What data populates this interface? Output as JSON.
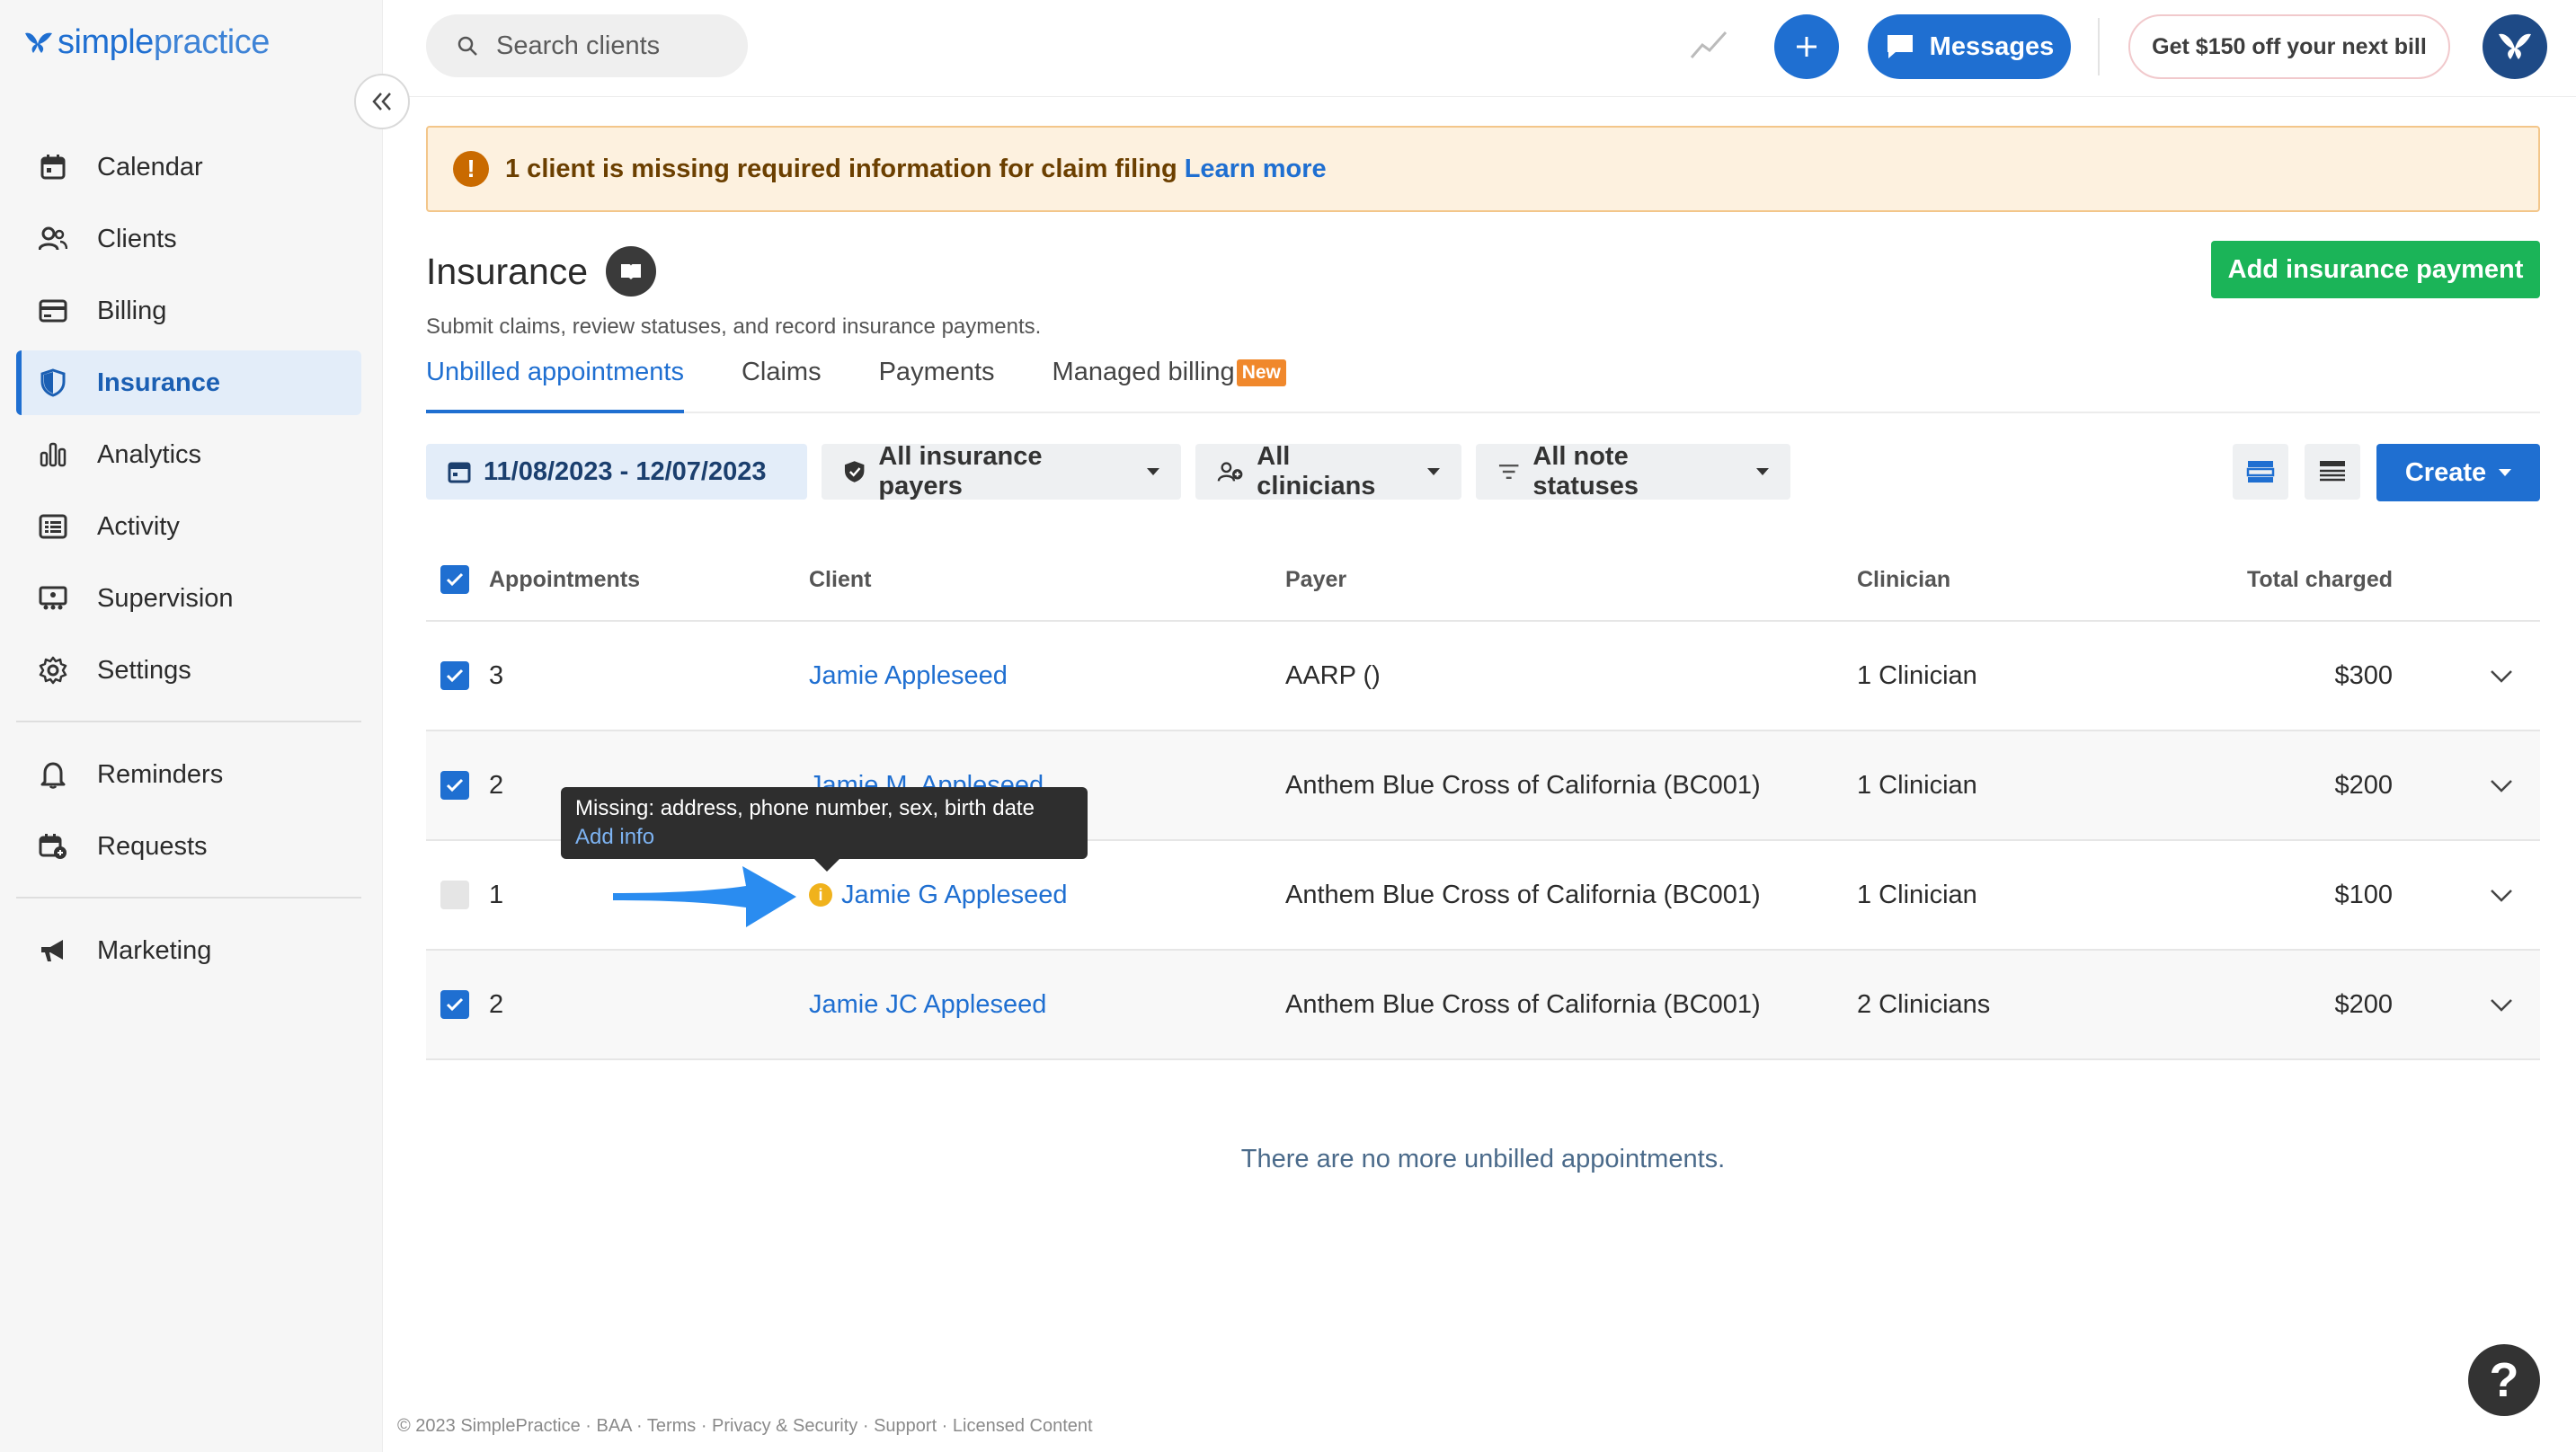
{
  "brand": {
    "logo_simple": "simple",
    "logo_practice": "practice"
  },
  "sidebar": {
    "items": [
      {
        "label": "Calendar",
        "icon": "calendar-icon"
      },
      {
        "label": "Clients",
        "icon": "clients-icon"
      },
      {
        "label": "Billing",
        "icon": "billing-icon"
      },
      {
        "label": "Insurance",
        "icon": "shield-icon",
        "active": true
      },
      {
        "label": "Analytics",
        "icon": "analytics-icon"
      },
      {
        "label": "Activity",
        "icon": "activity-icon"
      },
      {
        "label": "Supervision",
        "icon": "supervision-icon"
      },
      {
        "label": "Settings",
        "icon": "gear-icon"
      }
    ],
    "secondary": [
      {
        "label": "Reminders",
        "icon": "bell-icon"
      },
      {
        "label": "Requests",
        "icon": "requests-icon"
      }
    ],
    "tertiary": [
      {
        "label": "Marketing",
        "icon": "megaphone-icon"
      }
    ]
  },
  "topbar": {
    "search_placeholder": "Search clients",
    "messages_label": "Messages",
    "promo_label": "Get $150 off your next bill"
  },
  "alert": {
    "text": "1 client is missing required information for claim filing",
    "link": "Learn more"
  },
  "page": {
    "title": "Insurance",
    "subtitle": "Submit claims, review statuses, and record insurance payments.",
    "add_payment_label": "Add insurance payment"
  },
  "tabs": [
    {
      "label": "Unbilled appointments",
      "active": true
    },
    {
      "label": "Claims"
    },
    {
      "label": "Payments"
    },
    {
      "label": "Managed billing",
      "badge": "New"
    }
  ],
  "filters": {
    "date_range": "11/08/2023 - 12/07/2023",
    "payers": "All insurance payers",
    "clinicians": "All clinicians",
    "note_statuses": "All note statuses",
    "create_label": "Create"
  },
  "table": {
    "headers": {
      "appointments": "Appointments",
      "client": "Client",
      "payer": "Payer",
      "clinician": "Clinician",
      "total": "Total charged"
    },
    "rows": [
      {
        "checked": true,
        "appointments": "3",
        "client": "Jamie Appleseed",
        "payer": "AARP ()",
        "clinician": "1 Clinician",
        "total": "$300"
      },
      {
        "checked": true,
        "appointments": "2",
        "client": "Jamie M. Appleseed",
        "payer": "Anthem Blue Cross of California (BC001)",
        "clinician": "1 Clinician",
        "total": "$200"
      },
      {
        "checked": false,
        "warning": true,
        "appointments": "1",
        "client": "Jamie G Appleseed",
        "payer": "Anthem Blue Cross of California (BC001)",
        "clinician": "1 Clinician",
        "total": "$100"
      },
      {
        "checked": true,
        "appointments": "2",
        "client": "Jamie JC Appleseed",
        "payer": "Anthem Blue Cross of California (BC001)",
        "clinician": "2 Clinicians",
        "total": "$200"
      }
    ]
  },
  "tooltip": {
    "text": "Missing: address, phone number, sex, birth date",
    "link": "Add info"
  },
  "empty_message": "There are no more unbilled appointments.",
  "footer": "© 2023 SimplePractice · BAA · Terms · Privacy & Security · Support · Licensed Content",
  "colors": {
    "accent": "#1f6fd1",
    "success": "#1bb458",
    "warning": "#f0b21c",
    "alert_bg": "#fdf1df"
  }
}
